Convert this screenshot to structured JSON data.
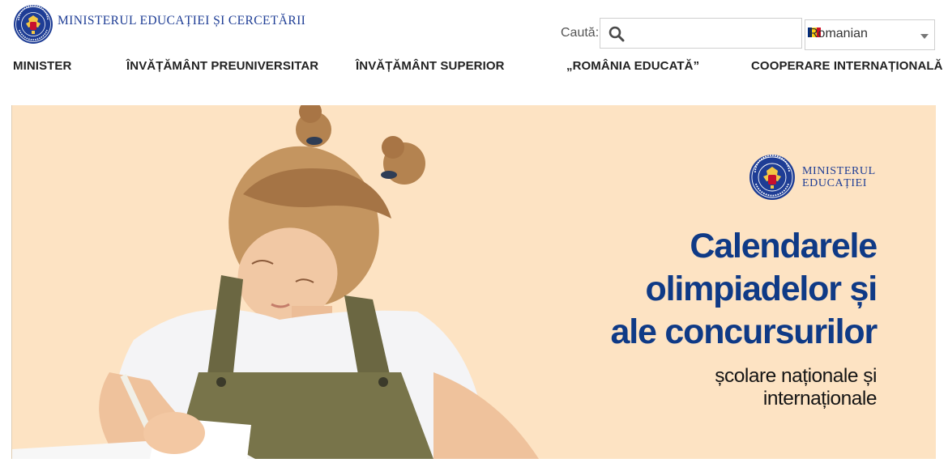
{
  "header": {
    "brand_name": "MINISTERUL EDUCAȚIEI ȘI CERCETĂRII",
    "search": {
      "label": "Caută:",
      "placeholder": "",
      "value": ""
    },
    "language": {
      "selected": "Romanian",
      "flag_colors": [
        "#002B7F",
        "#FCD116",
        "#CE1126"
      ]
    }
  },
  "nav": {
    "items": [
      {
        "label": "MINISTER"
      },
      {
        "label": "ÎNVĂȚĂMÂNT PREUNIVERSITAR"
      },
      {
        "label": "ÎNVĂȚĂMÂNT SUPERIOR"
      },
      {
        "label": "„ROMÂNIA EDUCATĂ”"
      },
      {
        "label": "COOPERARE INTERNAȚIONALĂ"
      }
    ]
  },
  "hero": {
    "logo_lines": [
      "MINISTERUL",
      "EDUCAȚIEI"
    ],
    "title_lines": [
      "Calendarele",
      "olimpiadelor și",
      "ale concursurilor"
    ],
    "subtitle_lines": [
      "școlare naționale și",
      "internaționale"
    ],
    "colors": {
      "background": "#fde3c3",
      "title": "#0f3a86",
      "brand": "#1e3d95"
    }
  },
  "icons": {
    "crest": "romanian-government-crest-icon",
    "search": "search-icon",
    "dropdown": "chevron-down-icon"
  }
}
